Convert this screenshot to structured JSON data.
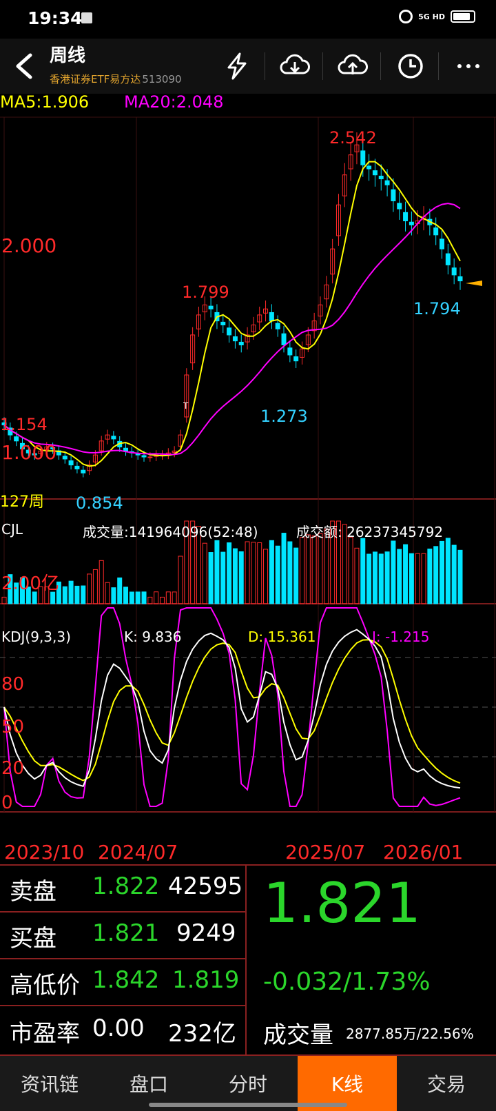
{
  "status": {
    "time": "19:34",
    "network": "5G HD"
  },
  "header": {
    "title": "周线",
    "subtitle_name": "香港证券ETF易方达",
    "subtitle_code": "513090",
    "icons": [
      "back-icon",
      "lightning-icon",
      "cloud-download-icon",
      "cloud-upload-icon",
      "clock-icon",
      "more-icon"
    ]
  },
  "main_chart": {
    "ma5_label": "MA5:1.906",
    "ma20_label": "MA20:2.048",
    "price_2000": "2.000",
    "price_1000": "1.000",
    "high_label": "2.542",
    "peak1_label": "1.799",
    "left_high_label": "1.154",
    "low_label": "0.854",
    "mid_low_label": "1.273",
    "last_low_label": "1.794",
    "period_label": "127周",
    "flag_T": "T",
    "colors": {
      "ma5": "#ffff00",
      "ma20": "#ff00ff",
      "up": "#ff2a2a",
      "down": "#00e5ff",
      "low_label": "#34d1ff",
      "high_label": "#ff2a2a"
    }
  },
  "volume_chart": {
    "name": "CJL",
    "volume_label": "成交量:141964096(52:48)",
    "amount_label": "成交额: 26237345792",
    "axis_label": "2.00亿"
  },
  "kdj_chart": {
    "name": "KDJ(9,3,3)",
    "k_label": "K: 9.836",
    "d_label": "D: 15.361",
    "j_label": "J: -1.215",
    "levels": [
      "80",
      "50",
      "20",
      "0"
    ]
  },
  "dates": [
    "2023/10",
    "2024/07",
    "2025/07",
    "2026/01"
  ],
  "chart_data": {
    "type": "candlestick",
    "period": "weekly",
    "visible_bars": 127,
    "x_labels": [
      "2023/10",
      "2024/07",
      "2025/07",
      "2026/01"
    ],
    "annotations": {
      "high": 2.542,
      "low": 0.854,
      "local_high_1": 1.799,
      "left_high": 1.154,
      "local_low": 1.273,
      "recent_low": 1.794
    },
    "ma5": 1.906,
    "ma20": 2.048,
    "close_series_approx": [
      1.1,
      1.05,
      1.02,
      0.98,
      0.96,
      0.95,
      0.97,
      0.99,
      0.98,
      0.95,
      0.93,
      0.9,
      0.88,
      0.86,
      0.9,
      0.95,
      1.02,
      1.05,
      1.03,
      0.99,
      0.97,
      0.96,
      0.95,
      0.94,
      0.94,
      0.95,
      0.95,
      0.96,
      0.97,
      1.05,
      1.35,
      1.55,
      1.65,
      1.7,
      1.68,
      1.62,
      1.6,
      1.55,
      1.52,
      1.5,
      1.55,
      1.6,
      1.65,
      1.68,
      1.62,
      1.58,
      1.5,
      1.45,
      1.42,
      1.48,
      1.55,
      1.62,
      1.7,
      1.8,
      1.98,
      2.2,
      2.35,
      2.45,
      2.5,
      2.4,
      2.38,
      2.35,
      2.33,
      2.3,
      2.22,
      2.18,
      2.12,
      2.1,
      2.12,
      2.14,
      2.1,
      2.05,
      1.98,
      1.9,
      1.85,
      1.82
    ]
  },
  "quote": {
    "sell_label": "卖盘",
    "sell_price": "1.822",
    "sell_vol": "42595",
    "buy_label": "买盘",
    "buy_price": "1.821",
    "buy_vol": "9249",
    "hl_label": "高低价",
    "high": "1.842",
    "low": "1.819",
    "pe_label": "市盈率",
    "pe": "0.00",
    "mcap": "232亿",
    "last_price": "1.821",
    "change": "-0.032/1.73%",
    "vol_label": "成交量",
    "vol_value": "2877.85万/22.56%"
  },
  "nav": {
    "items": [
      "资讯链",
      "盘口",
      "分时",
      "K线",
      "交易"
    ],
    "active": "K线"
  }
}
